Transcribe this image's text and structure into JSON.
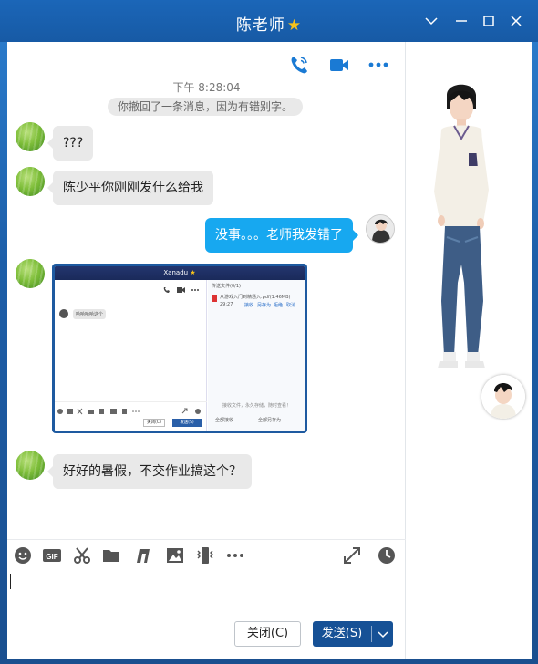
{
  "window": {
    "title": "陈老师",
    "title_badge_icon": "star-icon",
    "controls": [
      "dropdown-icon",
      "minimize-icon",
      "maximize-icon",
      "close-icon"
    ]
  },
  "chat_header": {
    "icons": [
      "phone-call-icon",
      "video-call-icon",
      "more-icon"
    ]
  },
  "messages": {
    "timestamp": "下午 8:28:04",
    "recall_notice": "你撤回了一条消息，因为有错别字。",
    "m1": "???",
    "m2": "陈少平你刚刚发什么给我",
    "m3": "没事。。。老师我发错了",
    "m5": "好好的暑假，不交作业搞这个？"
  },
  "screenshot": {
    "window_title": "Xanadu",
    "bubble_text": "哈哈哈哈这个",
    "right_header": "传送文件(0/1)",
    "file_name": "从游戏入门到精通入.pdf(1.46MB)",
    "file_time": "29:27",
    "file_actions": [
      "接收",
      "另存为",
      "拒绝",
      "取消"
    ],
    "notice": "接收文件，永久存储，随时查看！",
    "bottom_actions": [
      "全部接收",
      "全部另存为"
    ],
    "close_label": "关闭(C)",
    "send_label": "发送(S)"
  },
  "toolbar": {
    "icons": [
      "emoji-icon",
      "gif-icon",
      "screenshot-scissors-icon",
      "folder-icon",
      "music-icon",
      "image-icon",
      "shake-icon",
      "more-icon",
      "expand-icon",
      "history-clock-icon"
    ],
    "gif_label": "GIF"
  },
  "actions": {
    "close_label": "关闭",
    "close_key": "(C)",
    "send_label": "发送",
    "send_key": "(S)"
  },
  "colors": {
    "title_bar": "#175aa5",
    "accent_blue": "#1a7ad4",
    "outgoing_bubble": "#17a8f0",
    "incoming_bubble": "#e9e9e9",
    "send_button": "#165196",
    "star": "#f6c21b"
  }
}
